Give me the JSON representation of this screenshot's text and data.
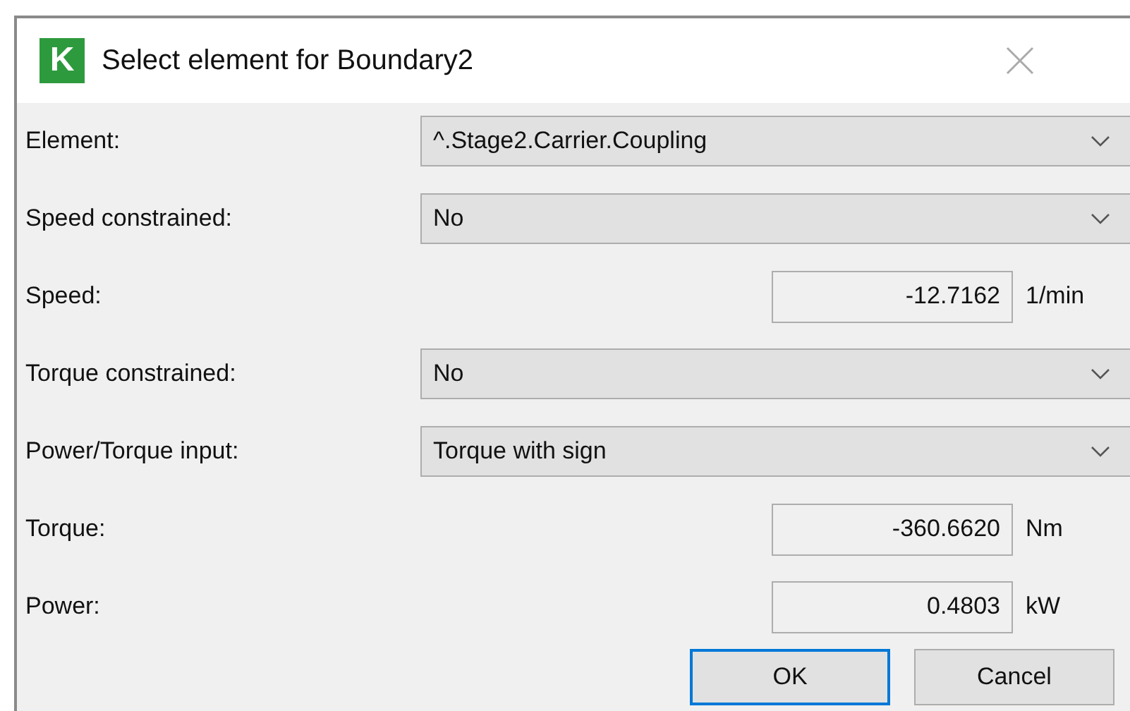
{
  "window": {
    "title": "Select element for Boundary2",
    "app_icon": "K"
  },
  "fields": [
    {
      "kind": "combo",
      "label": "Element:",
      "value": "^.Stage2.Carrier.Coupling"
    },
    {
      "kind": "combo",
      "label": "Speed constrained:",
      "value": "No"
    },
    {
      "kind": "number",
      "label": "Speed:",
      "value": "-12.7162",
      "unit": "1/min"
    },
    {
      "kind": "combo",
      "label": "Torque constrained:",
      "value": "No"
    },
    {
      "kind": "combo",
      "label": "Power/Torque input:",
      "value": "Torque with sign"
    },
    {
      "kind": "number",
      "label": "Torque:",
      "value": "-360.6620",
      "unit": "Nm"
    },
    {
      "kind": "number",
      "label": "Power:",
      "value": "0.4803",
      "unit": "kW"
    }
  ],
  "buttons": [
    {
      "label": "OK",
      "default": true
    },
    {
      "label": "Cancel",
      "default": false
    }
  ]
}
